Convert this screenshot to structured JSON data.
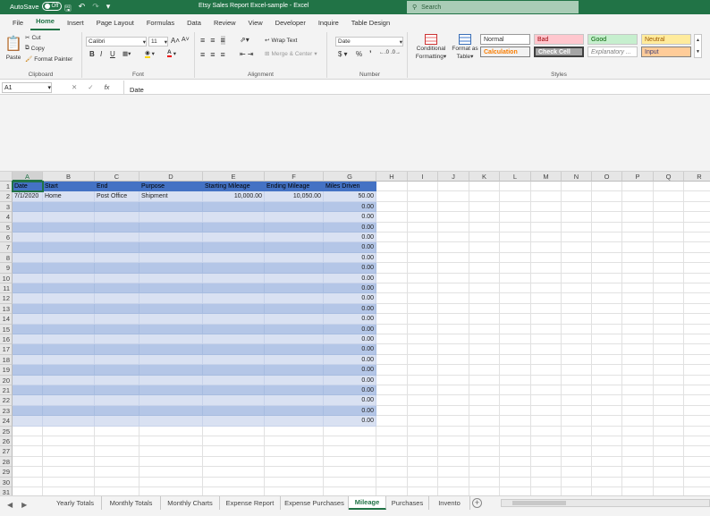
{
  "titlebar": {
    "autosave_label": "AutoSave",
    "autosave_state": "Off",
    "window_title": "Etsy Sales Report Excel-sample  -  Excel",
    "search_placeholder": "Search"
  },
  "menu_tabs": [
    "File",
    "Home",
    "Insert",
    "Page Layout",
    "Formulas",
    "Data",
    "Review",
    "View",
    "Developer",
    "Inquire",
    "Table Design"
  ],
  "active_menu_tab": "Home",
  "ribbon": {
    "clipboard": {
      "paste": "Paste",
      "cut": "Cut",
      "copy": "Copy",
      "format_painter": "Format Painter",
      "label": "Clipboard"
    },
    "font": {
      "name": "Calibri",
      "size": "11",
      "bold": "B",
      "italic": "I",
      "underline": "U",
      "grow": "A˄",
      "shrink": "A˅",
      "label": "Font"
    },
    "alignment": {
      "wrap": "Wrap Text",
      "merge": "Merge & Center",
      "label": "Alignment"
    },
    "number": {
      "format": "Date",
      "currency": "$",
      "percent": "%",
      "comma": "’",
      "label": "Number"
    },
    "styles": {
      "conditional_1": "Conditional",
      "conditional_2": "Formatting",
      "format_table_1": "Format as",
      "format_table_2": "Table",
      "normal": "Normal",
      "bad": "Bad",
      "good": "Good",
      "neutral": "Neutral",
      "calculation": "Calculation",
      "check_cell": "Check Cell",
      "explanatory": "Explanatory ...",
      "input": "Input",
      "label": "Styles"
    }
  },
  "formula_bar": {
    "name_box": "A1",
    "content": "Date"
  },
  "columns": [
    "A",
    "B",
    "C",
    "D",
    "E",
    "F",
    "G",
    "H",
    "I",
    "J",
    "K",
    "L",
    "M",
    "N",
    "O",
    "P",
    "Q",
    "R"
  ],
  "rows": [
    "1",
    "2",
    "3",
    "4",
    "5",
    "6",
    "7",
    "8",
    "9",
    "10",
    "11",
    "12",
    "13",
    "14",
    "15",
    "16",
    "17",
    "18",
    "19",
    "20",
    "21",
    "22",
    "23",
    "24",
    "25",
    "26",
    "27",
    "28",
    "29",
    "30",
    "31"
  ],
  "table": {
    "headers": [
      "Date",
      "Start",
      "End",
      "Purpose",
      "Starting Mileage",
      "Ending Mileage",
      "Miles Driven"
    ],
    "first_row": [
      "7/1/2020",
      "Home",
      "Post Office",
      "Shipment",
      "10,000.00",
      "10,050.00",
      "50.00"
    ],
    "miles_driven_rest": [
      "0.00",
      "0.00",
      "0.00",
      "0.00",
      "0.00",
      "0.00",
      "0.00",
      "0.00",
      "0.00",
      "0.00",
      "0.00",
      "0.00",
      "0.00",
      "0.00",
      "0.00",
      "0.00",
      "0.00",
      "0.00",
      "0.00",
      "0.00",
      "0.00",
      "0.00"
    ]
  },
  "sheet_tabs": [
    "Yearly Totals",
    "Monthly Totals",
    "Monthly Charts",
    "Expense Report",
    "Expense Purchases",
    "Mileage",
    "Purchases",
    "Invento"
  ],
  "active_sheet": "Mileage"
}
